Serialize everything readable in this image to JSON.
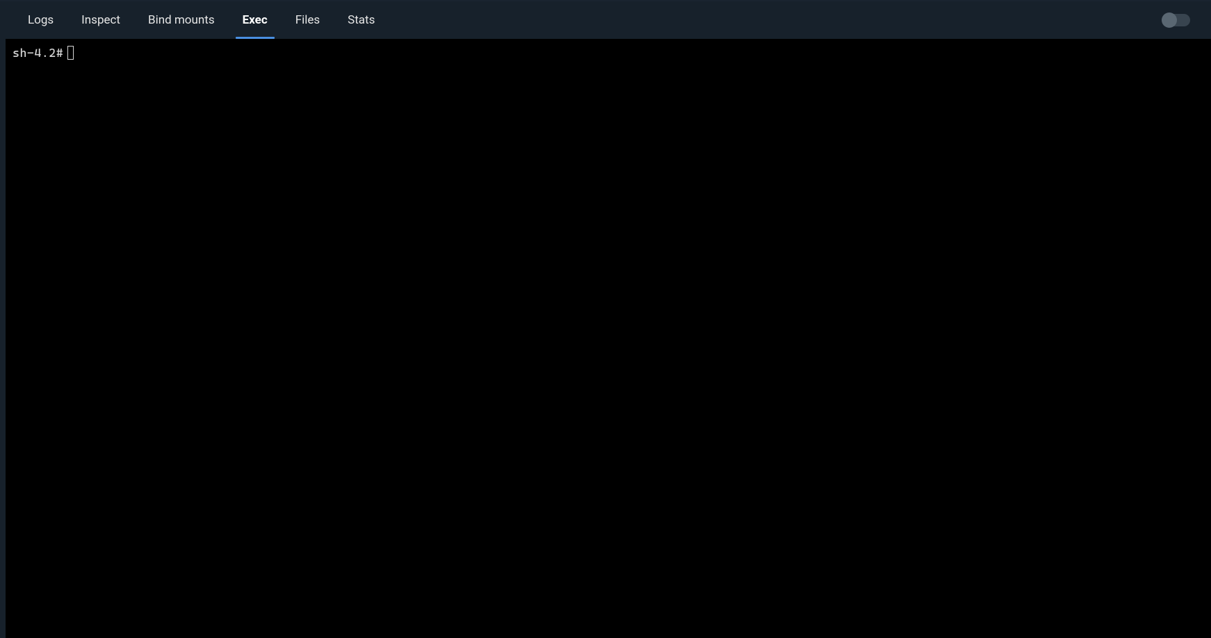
{
  "tabs": [
    {
      "label": "Logs",
      "active": false
    },
    {
      "label": "Inspect",
      "active": false
    },
    {
      "label": "Bind mounts",
      "active": false
    },
    {
      "label": "Exec",
      "active": true
    },
    {
      "label": "Files",
      "active": false
    },
    {
      "label": "Stats",
      "active": false
    }
  ],
  "toggle": {
    "on": false
  },
  "terminal": {
    "prompt": "sh-4.2#"
  }
}
